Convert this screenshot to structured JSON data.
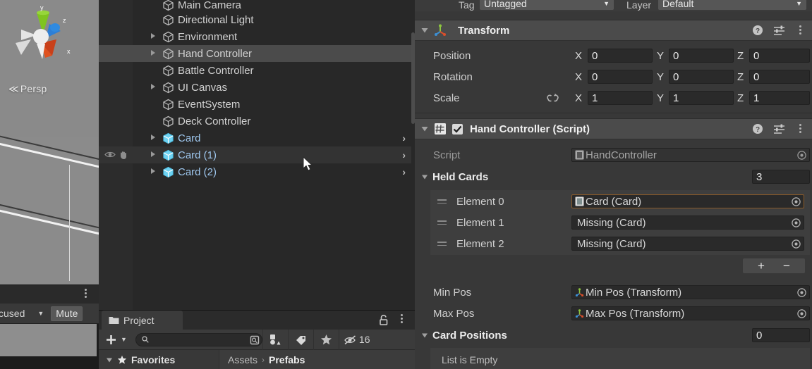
{
  "scene_view": {
    "gizmo_labels": {
      "y": "y",
      "z": "z",
      "x": "x"
    },
    "projection_label": "Persp",
    "projection_arrow": "≪"
  },
  "game_view": {
    "tab_label_partial": "cused",
    "focused_dropdown_value": "cused",
    "mute_button_label": "Mute",
    "kebab": "more-options"
  },
  "hierarchy": {
    "items": [
      {
        "label": "Main Camera",
        "indent": 1,
        "twisty": false,
        "prefab": false,
        "selected": false,
        "hover": false,
        "chevron": false,
        "clipped": true
      },
      {
        "label": "Directional Light",
        "indent": 1,
        "twisty": false,
        "prefab": false,
        "selected": false,
        "hover": false,
        "chevron": false
      },
      {
        "label": "Environment",
        "indent": 1,
        "twisty": true,
        "prefab": false,
        "selected": false,
        "hover": false,
        "chevron": false
      },
      {
        "label": "Hand Controller",
        "indent": 1,
        "twisty": true,
        "prefab": false,
        "selected": true,
        "hover": false,
        "chevron": false
      },
      {
        "label": "Battle Controller",
        "indent": 1,
        "twisty": false,
        "prefab": false,
        "selected": false,
        "hover": false,
        "chevron": false
      },
      {
        "label": "UI Canvas",
        "indent": 1,
        "twisty": true,
        "prefab": false,
        "selected": false,
        "hover": false,
        "chevron": false
      },
      {
        "label": "EventSystem",
        "indent": 1,
        "twisty": false,
        "prefab": false,
        "selected": false,
        "hover": false,
        "chevron": false
      },
      {
        "label": "Deck Controller",
        "indent": 1,
        "twisty": false,
        "prefab": false,
        "selected": false,
        "hover": false,
        "chevron": false
      },
      {
        "label": "Card",
        "indent": 1,
        "twisty": true,
        "prefab": true,
        "selected": false,
        "hover": false,
        "chevron": true
      },
      {
        "label": "Card (1)",
        "indent": 1,
        "twisty": true,
        "prefab": true,
        "selected": false,
        "hover": true,
        "chevron": true,
        "vis_icons": true
      },
      {
        "label": "Card (2)",
        "indent": 1,
        "twisty": true,
        "prefab": true,
        "selected": false,
        "hover": false,
        "chevron": true
      }
    ]
  },
  "project": {
    "tab_label": "Project",
    "lock_icon": "lock-icon",
    "kebab_icon": "more-options-icon",
    "add_button_label": "+",
    "search_placeholder": "",
    "search_value": "",
    "filters": [
      {
        "name": "asset-type-filter",
        "icon": "package-icon"
      },
      {
        "name": "label-filter",
        "icon": "tag-icon"
      },
      {
        "name": "favorites-filter",
        "icon": "star-icon"
      }
    ],
    "hidden_items_count": "16",
    "favorites_label": "Favorites",
    "breadcrumb": [
      "Assets",
      "Prefabs"
    ],
    "breadcrumb_separator": "›"
  },
  "inspector": {
    "tag_label": "Tag",
    "tag_value": "Untagged",
    "layer_label": "Layer",
    "layer_value": "Default",
    "transform": {
      "title": "Transform",
      "icon": "transform-gizmo-icon",
      "rows": [
        {
          "label": "Position",
          "x": "0",
          "y": "0",
          "z": "0",
          "link": false
        },
        {
          "label": "Rotation",
          "x": "0",
          "y": "0",
          "z": "0",
          "link": false
        },
        {
          "label": "Scale",
          "x": "1",
          "y": "1",
          "z": "1",
          "link": true
        }
      ],
      "axis_x": "X",
      "axis_y": "Y",
      "axis_z": "Z"
    },
    "hand_controller": {
      "title": "Hand Controller (Script)",
      "enabled": true,
      "script_label": "Script",
      "script_value": "HandController",
      "held_cards_label": "Held Cards",
      "held_cards_count": "3",
      "elements": [
        {
          "label": "Element 0",
          "value": "Card (Card)",
          "icon": "prefab-icon",
          "highlighted": true
        },
        {
          "label": "Element 1",
          "value": "Missing (Card)",
          "icon": "none",
          "highlighted": false
        },
        {
          "label": "Element 2",
          "value": "Missing (Card)",
          "icon": "none",
          "highlighted": false
        }
      ],
      "array_add_label": "+",
      "array_remove_label": "−",
      "min_pos_label": "Min Pos",
      "min_pos_value": "Min Pos (Transform)",
      "max_pos_label": "Max Pos",
      "max_pos_value": "Max Pos (Transform)",
      "card_positions_label": "Card Positions",
      "card_positions_count": "0",
      "card_positions_empty": "List is Empty"
    },
    "header_icons": [
      "help-icon",
      "preset-icon",
      "more-options-icon"
    ]
  },
  "colors": {
    "panel_bg": "#383838",
    "hierarchy_bg": "#282828",
    "selection": "#4b4b4b",
    "prefab_blue": "#9fc8ef",
    "field_bg": "#2a2a2a",
    "accent_orange": "#8a5a2a"
  }
}
